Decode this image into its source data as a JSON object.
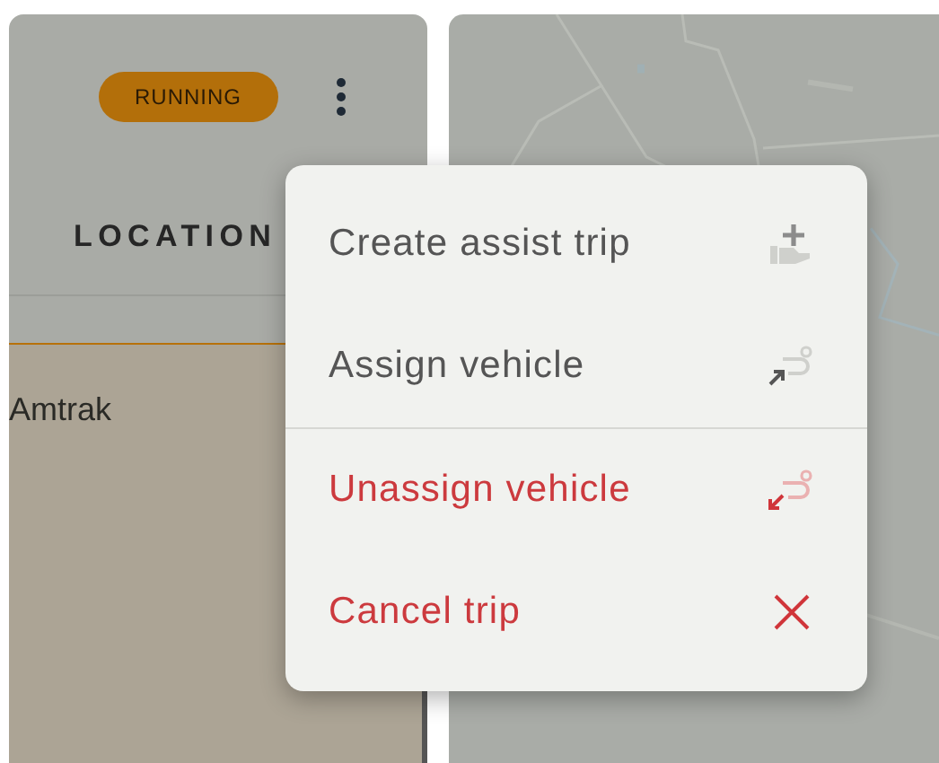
{
  "status_badge": {
    "label": "RUNNING"
  },
  "column_header": {
    "label": "LOCATION"
  },
  "card": {
    "text": "Amtrak",
    "selected": true
  },
  "menu": {
    "items": [
      {
        "label": "Create assist trip",
        "kind": "normal",
        "separator_before": false
      },
      {
        "label": "Assign vehicle",
        "kind": "normal",
        "separator_before": false
      },
      {
        "label": "Unassign vehicle",
        "kind": "danger",
        "separator_before": true
      },
      {
        "label": "Cancel trip",
        "kind": "danger",
        "separator_before": false
      }
    ]
  }
}
